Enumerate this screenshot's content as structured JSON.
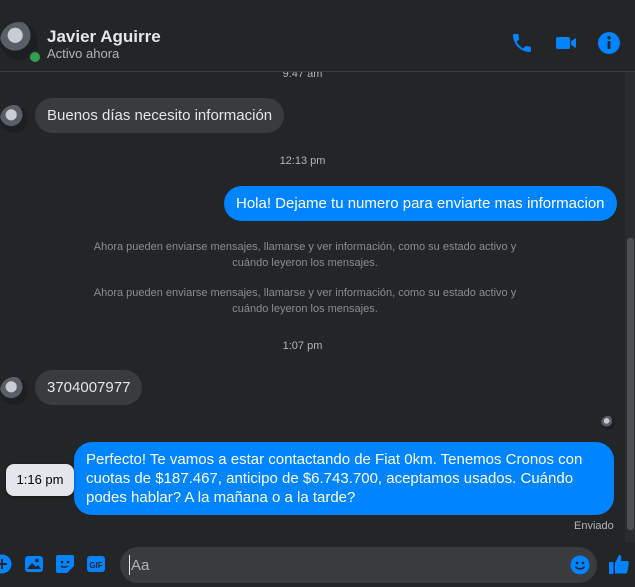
{
  "header": {
    "contact_name": "Javier Aguirre",
    "status": "Activo ahora",
    "icons": [
      "phone-icon",
      "video-camera-icon",
      "info-icon"
    ]
  },
  "conversation": {
    "timestamp_top": "9:47 am",
    "msg1": "Buenos días necesito información",
    "timestamp_2": "12:13 pm",
    "msg2": "Hola! Dejame tu numero para enviarte mas informacion",
    "system_notice_1": "Ahora pueden enviarse mensajes, llamarse y ver información, como su estado activo y cuándo leyeron los mensajes.",
    "system_notice_2": "Ahora pueden enviarse mensajes, llamarse y ver información, como su estado activo y cuándo leyeron los mensajes.",
    "timestamp_3": "1:07 pm",
    "msg3": "3704007977",
    "msg4": "Perfecto! Te vamos a estar contactando de Fiat 0km. Tenemos Cronos con cuotas de $187.467, anticipo de $6.743.700, aceptamos usados. Cuándo podes hablar? A la mañana o a la tarde?",
    "hover_time": "1:16 pm",
    "delivery_status": "Enviado"
  },
  "composer": {
    "placeholder": "Aa",
    "icons": [
      "plus-icon",
      "image-icon",
      "sticker-icon",
      "gif-icon",
      "emoji-icon",
      "thumbs-up-icon"
    ]
  },
  "colors": {
    "accent": "#0084ff",
    "background": "#242526",
    "incoming_bubble": "#3a3b3c"
  }
}
